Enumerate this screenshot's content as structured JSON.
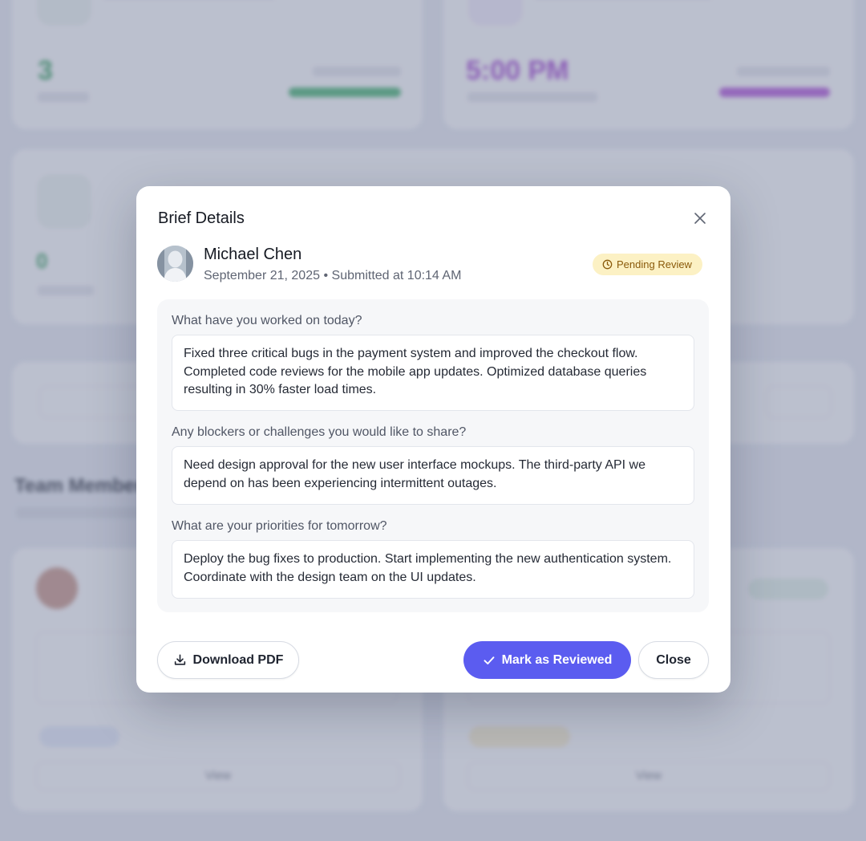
{
  "modal": {
    "title": "Brief Details",
    "person": {
      "name": "Michael Chen",
      "date": "September 21, 2025",
      "separator": "•",
      "submitted": "Submitted at 10:14 AM"
    },
    "status": "Pending Review",
    "questions": [
      {
        "question": "What have you worked on today?",
        "answer": "Fixed three critical bugs in the payment system and improved the checkout flow. Completed code reviews for the mobile app updates. Optimized database queries resulting in 30% faster load times."
      },
      {
        "question": "Any blockers or challenges you would like to share?",
        "answer": "Need design approval for the new user interface mockups. The third-party API we depend on has been experiencing intermittent outages."
      },
      {
        "question": "What are your priorities for tomorrow?",
        "answer": "Deploy the bug fixes to production. Start implementing the new authentication system. Coordinate with the design team on the UI updates."
      }
    ],
    "buttons": {
      "download": "Download PDF",
      "mark_reviewed": "Mark as Reviewed",
      "close": "Close"
    }
  },
  "background": {
    "stat_1": {
      "value": "3"
    },
    "stat_2": {
      "value": "5:00 PM"
    },
    "stat_3": {
      "value": "0"
    },
    "section_title": "Team Members",
    "view_label": "View"
  },
  "colors": {
    "accent": "#5b5cf0",
    "pending_bg": "#fcf1c4",
    "pending_text": "#8a5a0a",
    "green": "#3fb26b",
    "purple": "#b14fd9"
  }
}
